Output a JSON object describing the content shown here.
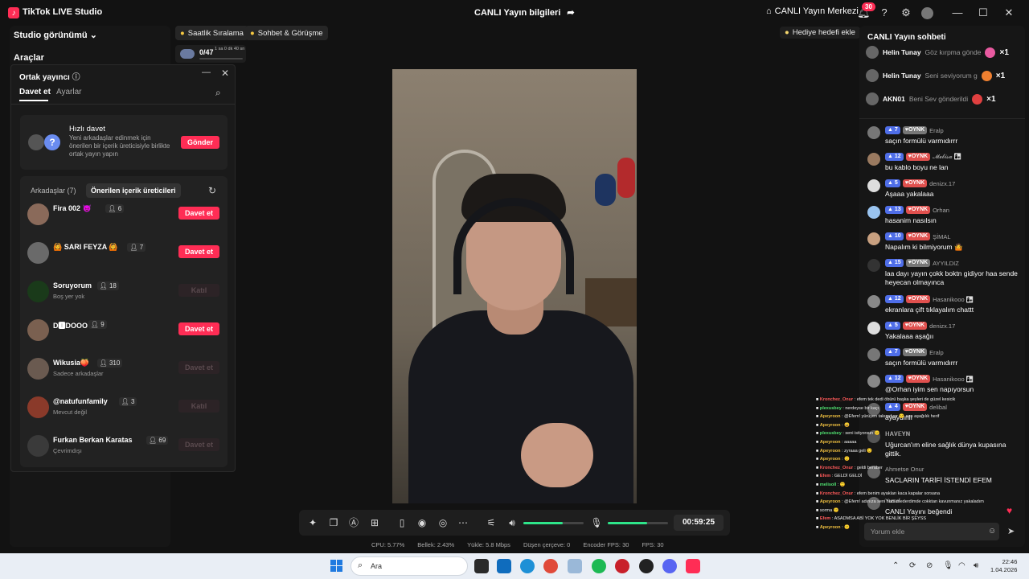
{
  "app": {
    "title": "TikTok LIVE Studio",
    "live_info": "CANLI Yayın bilgileri",
    "center_label": "CANLI Yayın Merkezi",
    "notif_count": "30"
  },
  "left": {
    "studio_view": "Studio görünümü",
    "tools": "Araçlar"
  },
  "pills": {
    "ranking": "Saatlik Sıralama",
    "chat_meet": "Sohbet & Görüşme",
    "progress_value": "0/47",
    "progress_time": "1 sa 0 dk 40 sn",
    "gift_goal": "Hediye hedefi ekle"
  },
  "cohost": {
    "title": "Ortak yayıncı",
    "tab_invite": "Davet et",
    "tab_settings": "Ayarlar",
    "quick_title": "Hızlı davet",
    "quick_desc": "Yeni arkadaşlar edinmek için önerilen bir içerik üreticisiyle birlikte ortak yayın yapın",
    "quick_button": "Gönder",
    "friends_tab": "Arkadaşlar (7)",
    "suggested_tab": "Önerilen içerik üreticileri",
    "rows": [
      {
        "name": "Fira 002 😈",
        "sub": "",
        "count": "6",
        "button": "Davet et",
        "enabled": true,
        "color": "#8a6a5a"
      },
      {
        "name": "🙆 SARI FEYZA 🙆",
        "sub": "",
        "count": "7",
        "button": "Davet et",
        "enabled": true,
        "color": "#6a6a6a"
      },
      {
        "name": "Soruyorum",
        "sub": "Boş yer yok",
        "count": "18",
        "button": "Katıl",
        "enabled": false,
        "color": "#1a3a1a"
      },
      {
        "name": "D🅸DOOO",
        "sub": "",
        "count": "9",
        "button": "Davet et",
        "enabled": true,
        "color": "#7a6050"
      },
      {
        "name": "Wikusia🍑",
        "sub": "Sadece arkadaşlar",
        "count": "310",
        "button": "Davet et",
        "enabled": false,
        "color": "#6a5a50"
      },
      {
        "name": "@natufunfamily",
        "sub": "Mevcut değil",
        "count": "3",
        "button": "Katıl",
        "enabled": false,
        "color": "#8a3a2a"
      },
      {
        "name": "Furkan Berkan Karatas",
        "sub": "Çevrimdışı",
        "count": "69",
        "button": "Davet et",
        "enabled": false,
        "color": "#3a3a3a"
      }
    ]
  },
  "controls": {
    "timer": "00:59:25",
    "speaker_level": 0.65,
    "mic_level": 0.65
  },
  "stats": {
    "cpu": "CPU: 5.77%",
    "memory": "Bellek: 2.43%",
    "upload": "Yükle: 5.8 Mbps",
    "dropped": "Düşen çerçeve: 0",
    "encoder_fps": "Encoder FPS: 30",
    "fps": "FPS: 30"
  },
  "chat": {
    "title": "CANLI Yayın sohbeti",
    "gifts": [
      {
        "user": "Helin Tunay",
        "msg": "Göz kırpma gönde",
        "x": "×1",
        "color": "#e85aa0"
      },
      {
        "user": "Helin Tunay",
        "msg": "Seni seviyorum g",
        "x": "×1",
        "color": "#f08030"
      },
      {
        "user": "AKN01",
        "msg": "Beni Sev gönderildi",
        "x": "×1",
        "color": "#e04040"
      }
    ],
    "messages": [
      {
        "lvl": "7",
        "fan": "OYNK",
        "fan_gray": true,
        "user": "Eralp",
        "text": "saçın formülü varmıdırrr",
        "color": "#777"
      },
      {
        "lvl": "12",
        "fan": "OYNK",
        "fan_gray": false,
        "user": "𝓜𝓮𝓵𝓲𝓼𝓪 👩‍👧",
        "text": "bu kablo boyu ne lan",
        "color": "#9a7a60"
      },
      {
        "lvl": "5",
        "fan": "OYNK",
        "fan_gray": false,
        "user": "denizx.17",
        "text": "Aşaaa yakalaaa",
        "color": "#ddd"
      },
      {
        "lvl": "13",
        "fan": "OYNK",
        "fan_gray": false,
        "user": "Orhan",
        "text": "hasanim nasılsın",
        "color": "#9ac4f0"
      },
      {
        "lvl": "10",
        "fan": "OYNK",
        "fan_gray": false,
        "user": "ŞİMAL",
        "text": "Napalım ki bilmiyorum 🤷",
        "color": "#c8a080"
      },
      {
        "lvl": "15",
        "fan": "OYNK",
        "fan_gray": true,
        "user": "AYYILDIZ",
        "text": "laa dayı yayın çokk boktn gidiyor haa sende heyecan olmayınca",
        "color": "#333"
      },
      {
        "lvl": "12",
        "fan": "OYNK",
        "fan_gray": false,
        "user": "Hasanikooo 👩‍👧",
        "text": "ekranlara çift tıklayalım chattt",
        "color": "#888"
      },
      {
        "lvl": "5",
        "fan": "OYNK",
        "fan_gray": false,
        "user": "denizx.17",
        "text": "Yakalaaa aşağıı",
        "color": "#ddd"
      },
      {
        "lvl": "7",
        "fan": "OYNK",
        "fan_gray": true,
        "user": "Eralp",
        "text": "saçın formülü varmıdırrr",
        "color": "#777"
      },
      {
        "lvl": "12",
        "fan": "OYNK",
        "fan_gray": false,
        "user": "Hasanikooo 👩‍👧",
        "text": "@Orhan iyim sen napıyorsun",
        "color": "#888"
      },
      {
        "lvl": "4",
        "fan": "OYNK",
        "fan_gray": false,
        "user": "delibal",
        "text": "ayaydınlı",
        "color": "#666"
      },
      {
        "lvl": "",
        "fan": "",
        "fan_gray": false,
        "user": "𝐇𝐀𝐕𝐄𝐘𝐍",
        "text": "Uğurcan'ım eline sağlık dünya kupasına gittik.",
        "color": "#555"
      },
      {
        "lvl": "",
        "fan": "",
        "fan_gray": false,
        "user": "Ahmetse Onur",
        "text": "SACLARIN TARİFİ İSTENDİ EFEM",
        "color": "#666"
      },
      {
        "lvl": "",
        "fan": "",
        "fan_gray": false,
        "user": "Yusuf",
        "text": "CANLI Yayını beğendi",
        "color": "#666"
      }
    ],
    "input_placeholder": "Yorum ekle"
  },
  "overlay": [
    {
      "user": "Kronchez_Onur",
      "text": ": efem tek dedi öbürü başka şeyleri de güzel kesicik",
      "cls": "ou3"
    },
    {
      "user": "plexusbey",
      "text": ": nerdeyse bir kaçı",
      "cls": "ou2"
    },
    {
      "user": "Apeyroon",
      "text": ": @Efem! yürüyen takımdyor 🙂 sen aşağılık herif",
      "cls": "ou"
    },
    {
      "user": "Apeyroon",
      "text": ": 😄",
      "cls": "ou"
    },
    {
      "user": "plexusbey",
      "text": ": seni istiyorsun 🙂",
      "cls": "ou2"
    },
    {
      "user": "Apeyroon",
      "text": ": aaaaa",
      "cls": "ou"
    },
    {
      "user": "Apeyroon",
      "text": ": zyraaa geli 🙂",
      "cls": "ou"
    },
    {
      "user": "Apeyroon",
      "text": ": 🙂",
      "cls": "ou"
    },
    {
      "user": "Kronchez_Onur",
      "text": ": geldi beraber",
      "cls": "ou3"
    },
    {
      "user": "Efem",
      "text": ": GELDİ GELDİ",
      "cls": "ou3"
    },
    {
      "user": "melisoll",
      "text": ": 🙂",
      "cls": "ou2"
    },
    {
      "user": "Kronchez_Onur",
      "text": ": efem benim ayakları kaca kapalar sorsana",
      "cls": "ou3"
    },
    {
      "user": "Apeyroon",
      "text": ": @Efem! adınıza seni hamımederdimde cokktan kavunmanız yakaladım",
      "cls": "ou"
    },
    {
      "user": "",
      "text": "sorma 🙂",
      "cls": "ou"
    },
    {
      "user": "Efem",
      "text": ": ASADMSA ABİ YOK YOK BENLİK BİR ŞEYSS",
      "cls": "ou3"
    },
    {
      "user": "Apeyroon",
      "text": ": 🙂",
      "cls": "ou"
    }
  ],
  "taskbar": {
    "search_placeholder": "Ara",
    "time": "22:46",
    "date": "1.04.2026"
  }
}
